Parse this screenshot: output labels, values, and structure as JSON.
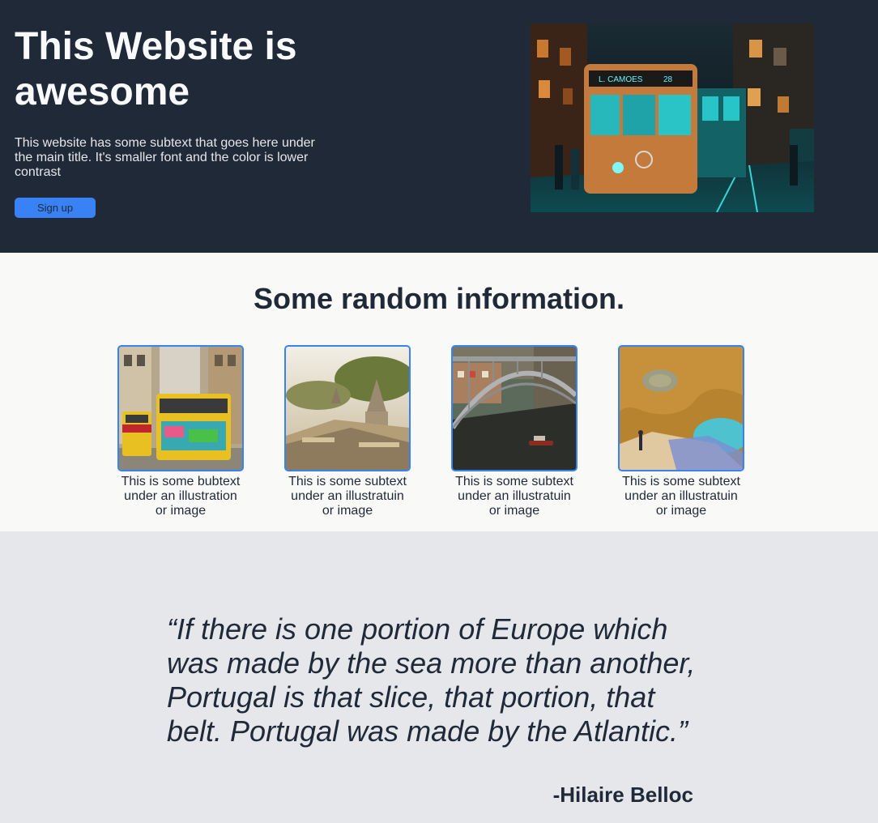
{
  "hero": {
    "title": "This Website is awesome",
    "subtext": "This website has some subtext that goes here under the main title. It's smaller font and the color is lower contrast",
    "signup_label": "Sign up",
    "tram_sign": "L. CAMOES",
    "tram_number": "28"
  },
  "info": {
    "title": "Some random information.",
    "cards": [
      {
        "image": "yellow-tram-street-image",
        "text": "This is some bubtext under an illustration or image"
      },
      {
        "image": "palace-rooftops-image",
        "text": "This is some subtext under an illustratuin or image"
      },
      {
        "image": "iron-bridge-river-image",
        "text": "This is some subtext under an illustratuin or image"
      },
      {
        "image": "sea-cave-beach-image",
        "text": "This is some subtext under an illustratuin or image"
      }
    ]
  },
  "quote": {
    "text": "“If there is one portion of Europe which was made by the sea more than another, Portugal is that slice, that portion, that belt. Portugal was made by the Atlantic.”",
    "author": "-Hilaire Belloc"
  },
  "colors": {
    "dark": "#1f2937",
    "accent": "#3882f6",
    "light": "#f9faf8",
    "gray": "#e5e7eb"
  }
}
